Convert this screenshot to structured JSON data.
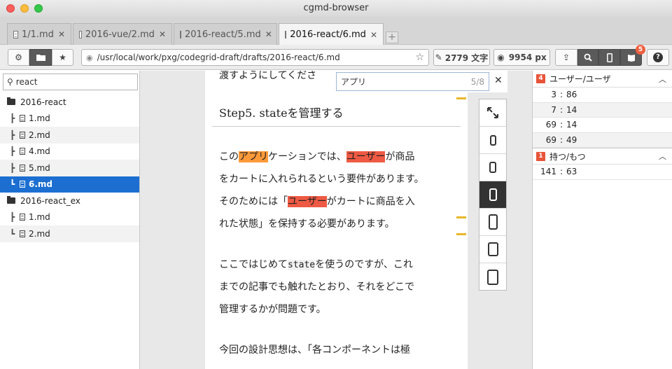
{
  "window": {
    "title": "cgmd-browser"
  },
  "tabs": [
    {
      "label": "1/1.md",
      "active": false
    },
    {
      "label": "2016-vue/2.md",
      "active": false
    },
    {
      "label": "2016-react/5.md",
      "active": false
    },
    {
      "label": "2016-react/6.md",
      "active": true
    }
  ],
  "toolbar": {
    "path": "/usr/local/work/pxg/codegrid-draft/drafts/2016-react/6.md",
    "char_count": "2779 文字",
    "width_px": "9954 px",
    "notification_count": "5"
  },
  "sidebar": {
    "search_value": "react",
    "tree": [
      {
        "type": "folder",
        "label": "2016-react"
      },
      {
        "type": "file",
        "label": "1.md",
        "branch": "┣"
      },
      {
        "type": "file",
        "label": "2.md",
        "branch": "┣"
      },
      {
        "type": "file",
        "label": "4.md",
        "branch": "┣"
      },
      {
        "type": "file",
        "label": "5.md",
        "branch": "┣"
      },
      {
        "type": "file",
        "label": "6.md",
        "branch": "┗",
        "selected": true
      },
      {
        "type": "folder",
        "label": "2016-react_ex"
      },
      {
        "type": "file",
        "label": "1.md",
        "branch": "┣"
      },
      {
        "type": "file",
        "label": "2.md",
        "branch": "┗"
      }
    ]
  },
  "find": {
    "query": "アプリ",
    "position": "5/8"
  },
  "document": {
    "top_line": "渡すようにしてくださ",
    "heading": "Step5. stateを管理する",
    "p1": {
      "l1a": "この",
      "l1hl1": "アプリ",
      "l1b": "ケーションでは、",
      "l1hl2": "ユーザー",
      "l1c": "が商品",
      "l2": "をカートに入れられるという要件があります。",
      "l3a": "そのためには「",
      "l3hl": "ユーザー",
      "l3b": "がカートに商品を入",
      "l4": "れた状態」を保持する必要があります。"
    },
    "p2": {
      "l1a": "ここではじめて",
      "l1code": "state",
      "l1b": "を使うのですが、これ",
      "l2": "までの記事でも触れたとおり、それをどこで",
      "l3": "管理するかが問題です。"
    },
    "p3": {
      "l1": "今回の設計思想は、「各コンポーネントは極"
    }
  },
  "matches": {
    "groups": [
      {
        "count": "4",
        "label": "ユーザー/ユーザ",
        "items": [
          {
            "line": "3",
            "col": "86"
          },
          {
            "line": "7",
            "col": "14"
          },
          {
            "line": "69",
            "col": "14"
          },
          {
            "line": "69",
            "col": "49"
          }
        ]
      },
      {
        "count": "1",
        "label": "持つ/もつ",
        "items": [
          {
            "line": "141",
            "col": "63"
          }
        ]
      }
    ]
  }
}
